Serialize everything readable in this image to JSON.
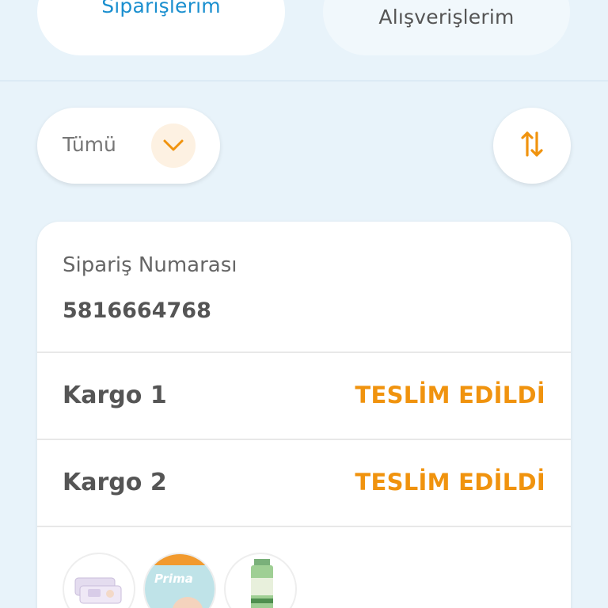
{
  "tabs": {
    "active_label": "Siparişlerim",
    "inactive_label": "Alışverişlerim"
  },
  "filter": {
    "label": "Tümü",
    "icon": "chevron-down-icon"
  },
  "sort": {
    "icon": "sort-arrows-icon"
  },
  "order": {
    "number_label": "Sipariş Numarası",
    "number": "5816664768",
    "cargos": [
      {
        "name": "Kargo 1",
        "status": "TESLİM EDİLDİ"
      },
      {
        "name": "Kargo 2",
        "status": "TESLİM EDİLDİ"
      }
    ],
    "product_badge_text": "Prima"
  },
  "colors": {
    "accent": "#f0930e",
    "link": "#1a8fcf",
    "background": "#e8f3fa"
  }
}
